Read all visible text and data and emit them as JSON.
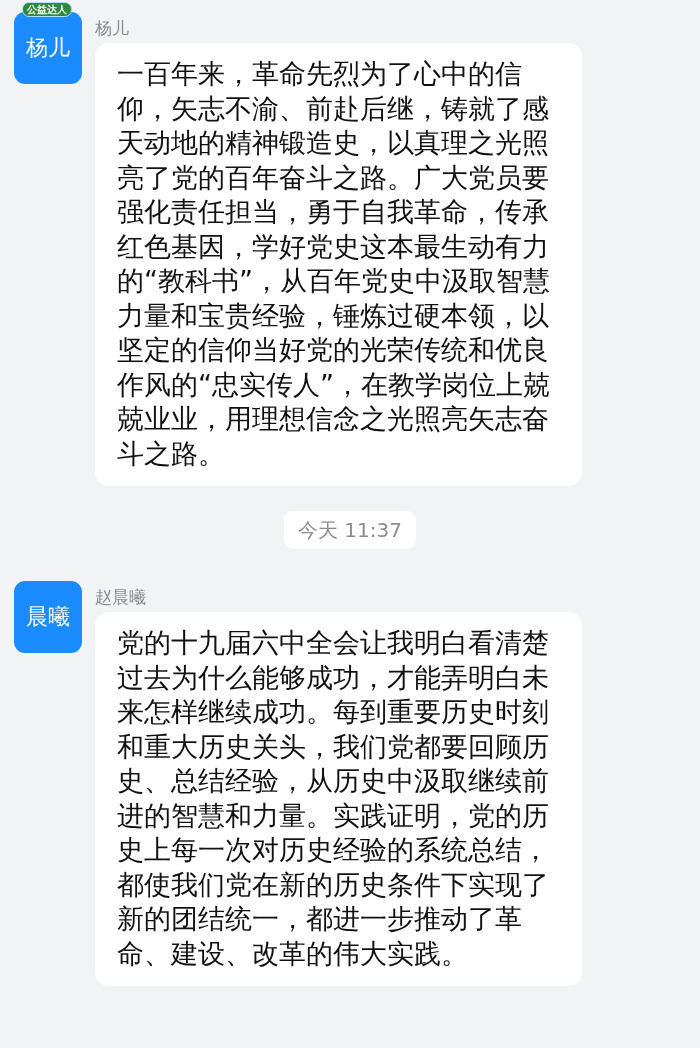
{
  "items": [
    {
      "kind": "message",
      "sender": "杨儿",
      "avatar_text": "杨儿",
      "badge": "公益达人",
      "text": "一百年来，革命先烈为了心中的信仰，矢志不渝、前赴后继，铸就了感天动地的精神锻造史，以真理之光照亮了党的百年奋斗之路。广大党员要强化责任担当，勇于自我革命，传承红色基因，学好党史这本最生动有力的“教科书”，从百年党史中汲取智慧力量和宝贵经验，锤炼过硬本领，以坚定的信仰当好党的光荣传统和优良作风的“忠实传人”，在教学岗位上兢兢业业，用理想信念之光照亮矢志奋斗之路。"
    },
    {
      "kind": "timestamp",
      "text": "今天 11:37"
    },
    {
      "kind": "message",
      "sender": "赵晨曦",
      "avatar_text": "晨曦",
      "text": "党的十九届六中全会让我明白看清楚过去为什么能够成功，才能弄明白未来怎样继续成功。每到重要历史时刻和重大历史关头，我们党都要回顾历史、总结经验，从历史中汲取继续前进的智慧和力量。实践证明，党的历史上每一次对历史经验的系统总结，都使我们党在新的历史条件下实现了新的团结统一，都进一步推动了革命、建设、改革的伟大实践。"
    }
  ]
}
